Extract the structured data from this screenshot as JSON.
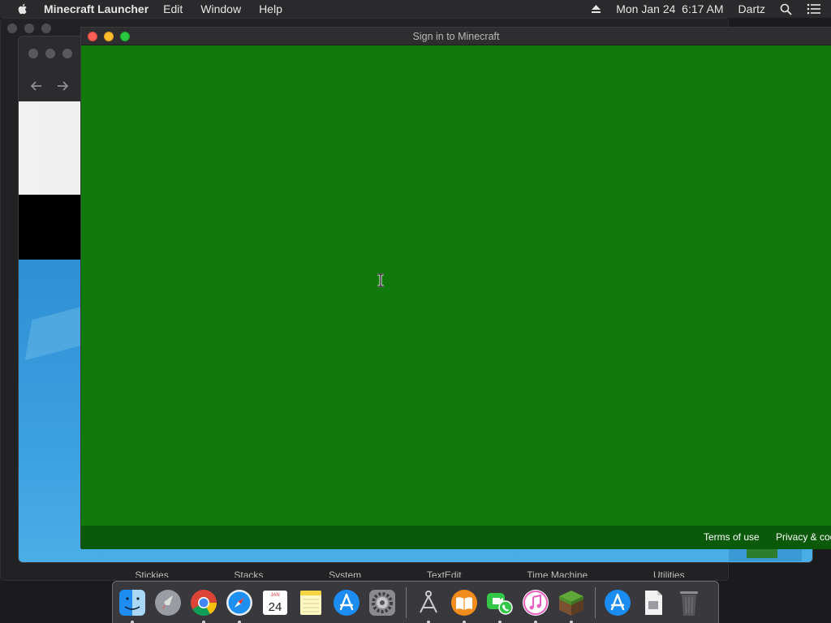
{
  "menubar": {
    "app_name": "Minecraft Launcher",
    "items": [
      "Edit",
      "Window",
      "Help"
    ],
    "datetime": "Mon Jan 24  6:17 AM",
    "user": "Dartz"
  },
  "signin": {
    "title": "Sign in to Minecraft",
    "footer": {
      "terms": "Terms of use",
      "privacy": "Privacy & coo"
    }
  },
  "background": {
    "utilities": [
      "Stickies",
      "Stacks",
      "System",
      "TextEdit",
      "Time Machine",
      "Utilities"
    ]
  },
  "dock": {
    "calendar_month": "JAN",
    "calendar_day": "24"
  },
  "colors": {
    "signin_bg": "#107a0d",
    "signin_footer": "#0b5a0a",
    "menubar_bg": "#2a2a2c"
  }
}
